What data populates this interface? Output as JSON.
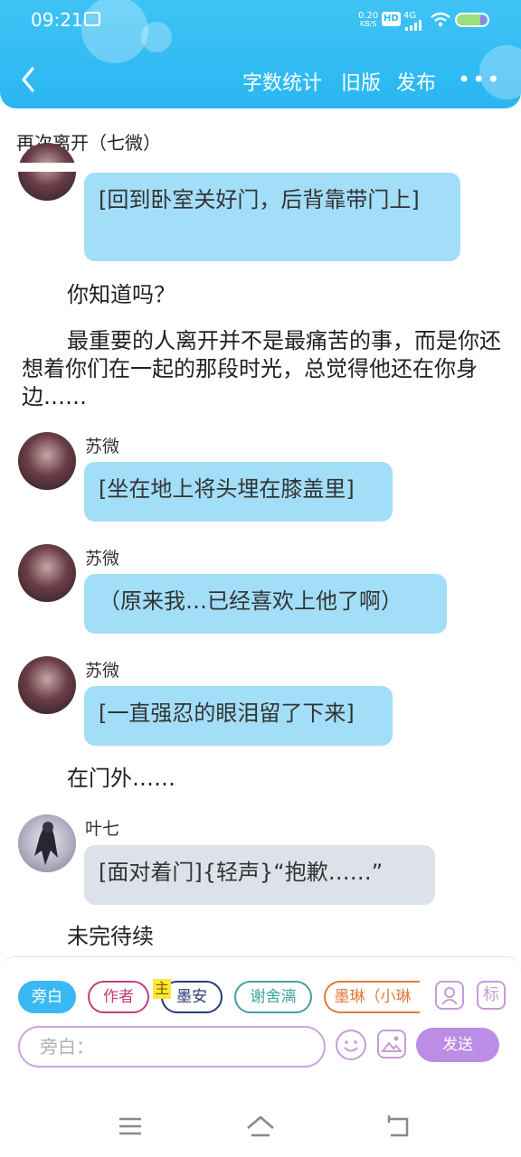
{
  "status_bar": {
    "time": "09:21",
    "speed": "0.20",
    "speed_unit": "KB/S",
    "hd": "HD",
    "network": "4G"
  },
  "header": {
    "word_count": "字数统计",
    "old_version": "旧版",
    "publish": "发布",
    "more": "•••"
  },
  "title": "再次离开（七微）",
  "messages": {
    "m1": {
      "text": "[回到卧室关好门，后背靠带门上]"
    },
    "n1": {
      "text": "你知道吗？"
    },
    "n2": {
      "text": "最重要的人离开并不是最痛苦的事，而是你还想着你们在一起的那段时光，总觉得他还在你身边……"
    },
    "m2": {
      "speaker": "苏微",
      "text": "[坐在地上将头埋在膝盖里]"
    },
    "m3": {
      "speaker": "苏微",
      "text": "（原来我…已经喜欢上他了啊）"
    },
    "m4": {
      "speaker": "苏微",
      "text": "[一直强忍的眼泪留了下来]"
    },
    "n3": {
      "text": "在门外……"
    },
    "m5": {
      "speaker": "叶七",
      "text": "[面对着门]{轻声}“抱歉……”"
    },
    "n4": {
      "text": "未完待续"
    }
  },
  "roles": {
    "narration": "旁白",
    "author": "作者",
    "main_badge": "主",
    "moan": "墨安",
    "xie": "谢舍漓",
    "molin": "墨琳（小琳"
  },
  "panel": {
    "tag_icon": "标",
    "input_placeholder": "旁白：",
    "send": "发送"
  },
  "colors": {
    "header": "#2ab6f2",
    "bubble_blue": "#a3def8",
    "bubble_gray": "#dde2ea",
    "accent": "#bb8de4"
  },
  "icons": [
    "back-arrow-icon",
    "wifi-icon",
    "battery-icon",
    "contact-icon",
    "emoji-icon",
    "image-icon",
    "menu-icon",
    "home-icon",
    "back-icon"
  ]
}
